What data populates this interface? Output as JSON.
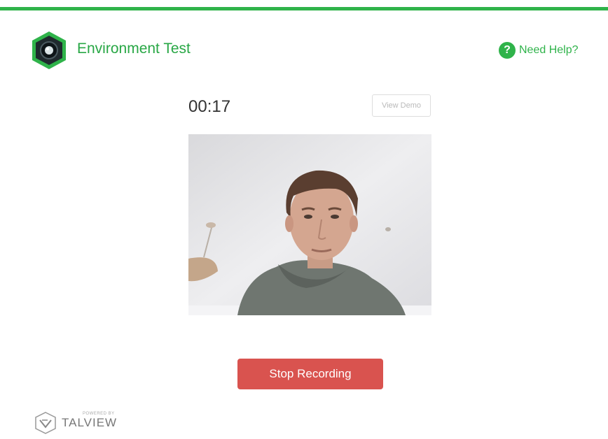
{
  "header": {
    "app_title": "Environment Test",
    "logo_icon": "camera-hexagon-icon",
    "help_label": "Need Help?",
    "help_icon": "question-circle-icon",
    "accent_color": "#2fb34a"
  },
  "recorder": {
    "timer": "00:17",
    "view_demo_label": "View Demo",
    "video_feed": "webcam-preview",
    "stop_label": "Stop Recording",
    "stop_color": "#d9534f"
  },
  "footer": {
    "powered_by": "POWERED BY",
    "brand_name": "TALVIEW"
  }
}
